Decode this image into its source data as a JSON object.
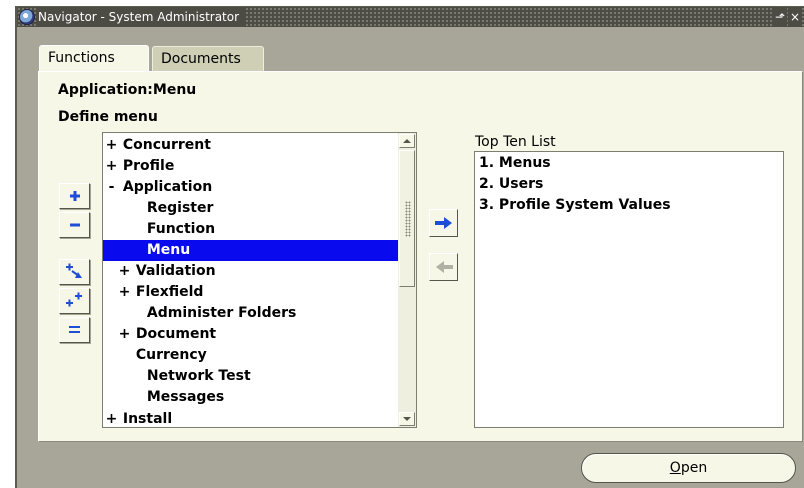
{
  "window": {
    "title": "Navigator - System Administrator",
    "minimize_glyph": "⬏",
    "close_glyph": "×"
  },
  "tabs": [
    {
      "label": "Functions",
      "active": true
    },
    {
      "label": "Documents",
      "active": false
    }
  ],
  "headings": {
    "application": "Application:Menu",
    "define": "Define menu"
  },
  "side_buttons": [
    {
      "name": "expand-button",
      "icon": "plus-icon"
    },
    {
      "name": "collapse-button",
      "icon": "minus-icon"
    },
    {
      "name": "expand-branch-button",
      "icon": "expand-branch-icon"
    },
    {
      "name": "expand-all-button",
      "icon": "expand-all-icon"
    },
    {
      "name": "collapse-all-button",
      "icon": "collapse-all-icon"
    }
  ],
  "tree": {
    "items": [
      {
        "expander": "+",
        "label": "Concurrent",
        "level": 0
      },
      {
        "expander": "+",
        "label": "Profile",
        "level": 0
      },
      {
        "expander": "-",
        "label": "Application",
        "level": 0
      },
      {
        "expander": "",
        "label": "Register",
        "level": 1
      },
      {
        "expander": "",
        "label": "Function",
        "level": 1
      },
      {
        "expander": "",
        "label": "Menu",
        "level": 1,
        "selected": true
      },
      {
        "expander": "+",
        "label": "Validation",
        "level": 1
      },
      {
        "expander": "+",
        "label": "Flexfield",
        "level": 1
      },
      {
        "expander": "",
        "label": "Administer Folders",
        "level": 1
      },
      {
        "expander": "+",
        "label": "Document",
        "level": 1
      },
      {
        "expander": "",
        "label": "Currency",
        "level": 1
      },
      {
        "expander": "",
        "label": "Network Test",
        "level": 1
      },
      {
        "expander": "",
        "label": "Messages",
        "level": 1
      },
      {
        "expander": "+",
        "label": "Install",
        "level": 0
      }
    ]
  },
  "top_ten": {
    "label": "Top Ten List",
    "items": [
      "1. Menus",
      "2. Users",
      "3. Profile System Values"
    ]
  },
  "buttons": {
    "add_to_top_ten": "right-arrow-icon",
    "remove_from_top_ten": "left-arrow-icon",
    "open_prefix": "",
    "open_mnemonic": "O",
    "open_rest": "pen"
  },
  "colors": {
    "selection": "#0a0aef",
    "panel": "#f7f7e7",
    "window": "#a8a699",
    "arrow_active": "#1d4fd6"
  }
}
